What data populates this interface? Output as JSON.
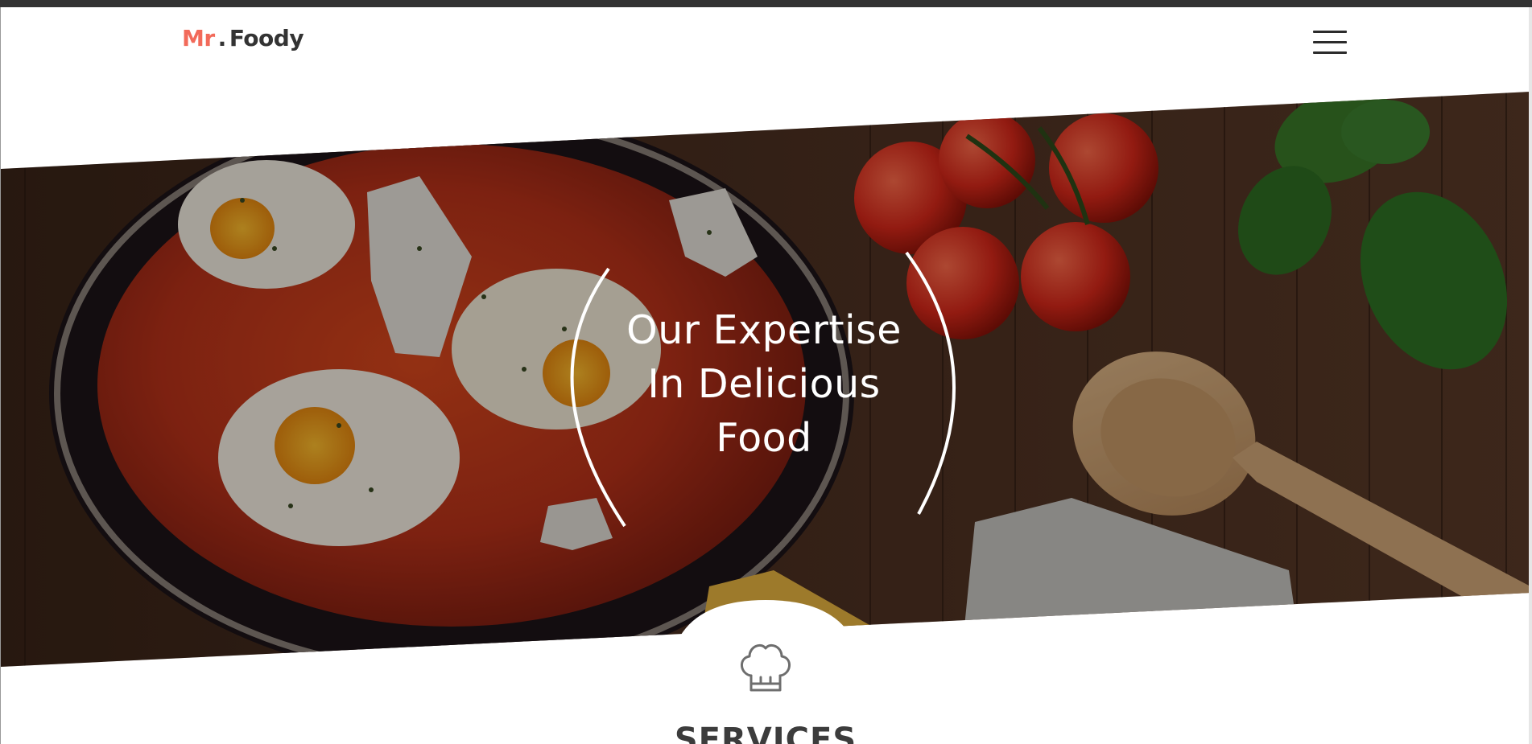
{
  "brand": {
    "name_part1": "Mr",
    "separator": ".",
    "name_part2": "Foody",
    "accent_color": "#f26a5a",
    "text_color": "#333333"
  },
  "nav": {
    "menu_icon": "hamburger-menu-icon"
  },
  "hero": {
    "line1": "Our Expertise",
    "line2": "In Delicious",
    "line3": "Food",
    "image_subject": "shakshuka pan with eggs, cherry tomatoes, basil and wooden spoon on dark wood table"
  },
  "services": {
    "icon": "chef-hat-icon",
    "heading": "SERVICES"
  }
}
